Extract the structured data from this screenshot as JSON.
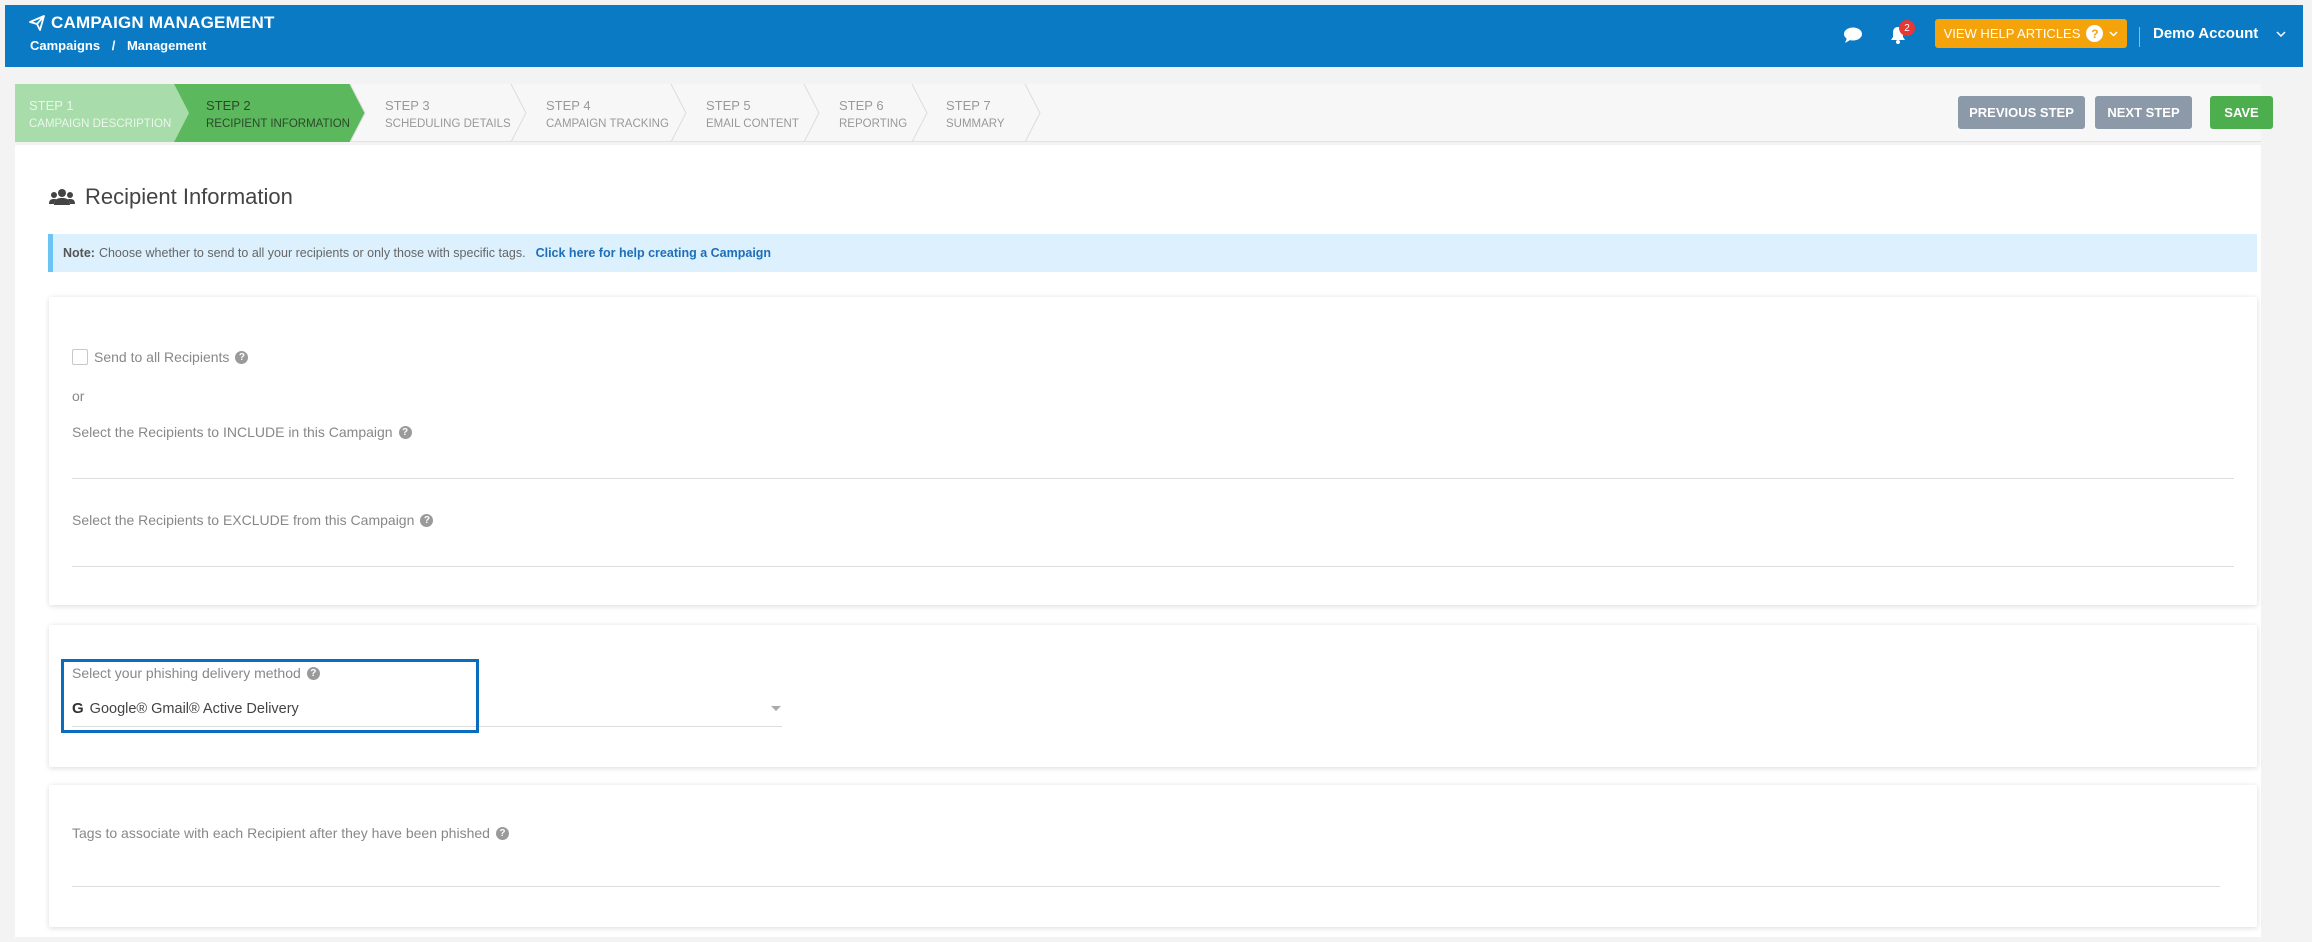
{
  "header": {
    "app_title": "CAMPAIGN MANAGEMENT",
    "breadcrumb": [
      "Campaigns",
      "Management"
    ],
    "breadcrumb_sep": "/",
    "notification_count": "2",
    "help_button_label": "VIEW HELP ARTICLES",
    "account_name": "Demo Account",
    "icons": [
      "paper-plane-icon",
      "chat-bubble-icon",
      "bell-icon",
      "question-icon",
      "chevron-down-icon"
    ]
  },
  "steps": [
    {
      "step": "STEP 1",
      "label": "CAMPAIGN DESCRIPTION",
      "state": "completed"
    },
    {
      "step": "STEP 2",
      "label": "RECIPIENT INFORMATION",
      "state": "active"
    },
    {
      "step": "STEP 3",
      "label": "SCHEDULING DETAILS",
      "state": "pending"
    },
    {
      "step": "STEP 4",
      "label": "CAMPAIGN TRACKING",
      "state": "pending"
    },
    {
      "step": "STEP 5",
      "label": "EMAIL CONTENT",
      "state": "pending"
    },
    {
      "step": "STEP 6",
      "label": "REPORTING",
      "state": "pending"
    },
    {
      "step": "STEP 7",
      "label": "SUMMARY",
      "state": "pending"
    }
  ],
  "toolbar": {
    "previous_label": "PREVIOUS STEP",
    "next_label": "NEXT STEP",
    "save_label": "SAVE"
  },
  "section": {
    "title": "Recipient Information",
    "icon": "users-icon"
  },
  "note": {
    "prefix": "Note:",
    "text": "Choose whether to send to all your recipients or only those with specific tags.",
    "link": "Click here for help creating a Campaign"
  },
  "recipients": {
    "send_all_label": "Send to all Recipients",
    "send_all_checked": false,
    "or_text": "or",
    "include_label": "Select the Recipients to INCLUDE in this Campaign",
    "exclude_label": "Select the Recipients to EXCLUDE from this Campaign"
  },
  "delivery": {
    "label": "Select your phishing delivery method",
    "selected_value": "Google® Gmail® Active Delivery",
    "icon": "google-icon"
  },
  "tags": {
    "label": "Tags to associate with each Recipient after they have been phished"
  },
  "colors": {
    "header_bg": "#0a7ac5",
    "help_button": "#f5a30a",
    "step_completed": "#a8dcaa",
    "step_active": "#5cb85c",
    "save_button": "#4cae4c",
    "nav_buttons": "#8b99a8",
    "note_bg": "#dcf0fd",
    "focus_border": "#0a6cbc"
  }
}
